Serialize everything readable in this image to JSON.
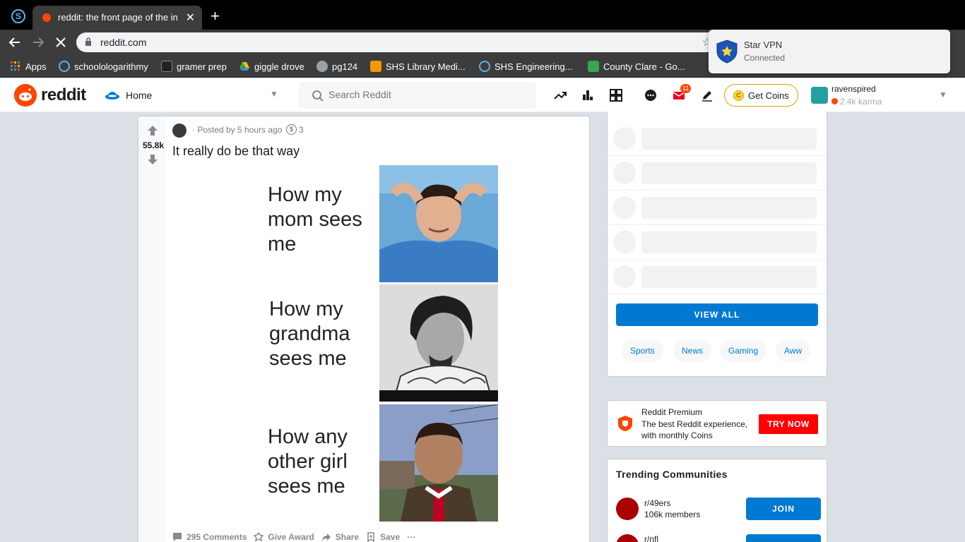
{
  "browser": {
    "profile_letter": "S",
    "tab_title": "reddit: the front page of the internet",
    "new_tab": "+",
    "close_glyph": "✕",
    "url": "reddit.com",
    "bookmarks": [
      {
        "label": "Apps",
        "color": "#e94235"
      },
      {
        "label": "schoolologarithmy",
        "color": "#5fb3e8"
      },
      {
        "label": "gramer prep",
        "color": "#222222"
      },
      {
        "label": "giggle drove",
        "color": "#34a853"
      },
      {
        "label": "pg124",
        "color": "#9aa0a6"
      },
      {
        "label": "SHS Library Medi...",
        "color": "#f29900"
      },
      {
        "label": "SHS Engineering...",
        "color": "#5fb3e8"
      },
      {
        "label": "County Clare - Go...",
        "color": "#34a853"
      }
    ]
  },
  "vpn": {
    "title": "Star VPN",
    "status": "Connected"
  },
  "header": {
    "wordmark": "reddit",
    "home_label": "Home",
    "search_placeholder": "Search Reddit",
    "mail_badge": "11",
    "get_coins": "Get Coins",
    "coin_glyph": "C",
    "username": "ravenspired",
    "karma": "2.4k karma"
  },
  "post": {
    "score": "55.8k",
    "posted": "· Posted by 5 hours ago",
    "award_count": "3",
    "title": "It really do be that way",
    "meme_captions": [
      "How my\nmom sees\nme",
      "How my\ngrandma\nsees me",
      "How any\nother girl\nsees me"
    ],
    "actions": {
      "comments": "295 Comments",
      "award": "Give Award",
      "share": "Share",
      "save": "Save",
      "more": "···"
    }
  },
  "sidebar": {
    "view_all": "VIEW ALL",
    "pills": [
      "Sports",
      "News",
      "Gaming",
      "Aww"
    ]
  },
  "premium": {
    "title": "Reddit Premium",
    "desc": "The best Reddit experience, with monthly Coins",
    "button": "TRY NOW"
  },
  "trending": {
    "title": "Trending Communities",
    "communities": [
      {
        "name": "r/49ers",
        "members": "106k members",
        "join": "JOIN"
      },
      {
        "name": "r/nfl",
        "members": "",
        "join": ""
      }
    ]
  },
  "colors": {
    "reddit_orange": "#ff4500",
    "reddit_blue": "#0079d3",
    "premium_red": "#ff0000",
    "page_bg": "#dae0e6"
  }
}
